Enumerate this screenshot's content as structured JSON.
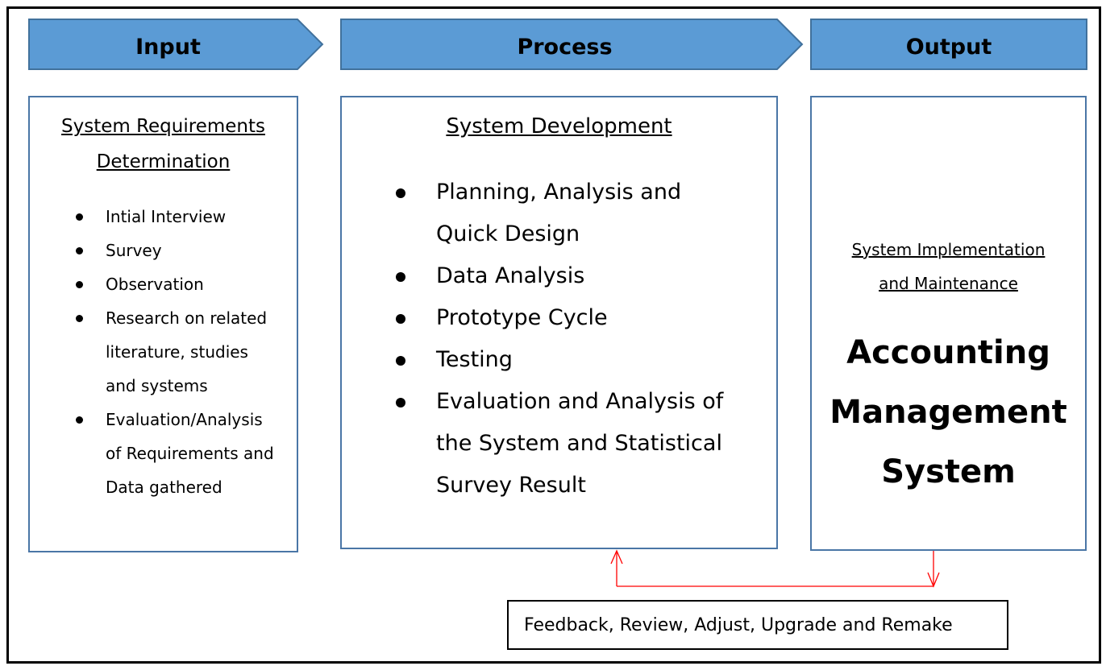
{
  "diagram": {
    "headers": {
      "input": "Input",
      "process": "Process",
      "output": "Output"
    },
    "input_box": {
      "title_line1": "System Requirements",
      "title_line2": "Determination",
      "items": [
        {
          "lines": [
            "Intial Interview"
          ]
        },
        {
          "lines": [
            "Survey"
          ]
        },
        {
          "lines": [
            "Observation"
          ]
        },
        {
          "lines": [
            "Research on related",
            "literature, studies",
            "and systems"
          ]
        },
        {
          "lines": [
            "Evaluation/Analysis",
            "of Requirements and",
            "Data gathered"
          ]
        }
      ]
    },
    "process_box": {
      "title": "System Development",
      "items": [
        {
          "lines": [
            "Planning, Analysis and",
            "Quick Design"
          ]
        },
        {
          "lines": [
            "Data Analysis"
          ]
        },
        {
          "lines": [
            "Prototype Cycle"
          ]
        },
        {
          "lines": [
            "Testing"
          ]
        },
        {
          "lines": [
            "Evaluation and Analysis of",
            "the System and Statistical",
            "Survey Result"
          ]
        }
      ]
    },
    "output_box": {
      "subtitle_line1": "System Implementation",
      "subtitle_line2": "and Maintenance",
      "main_line1": "Accounting",
      "main_line2": "Management",
      "main_line3": "System"
    },
    "feedback": {
      "label": "Feedback, Review, Adjust, Upgrade and Remake"
    },
    "colors": {
      "header_fill": "#5b9bd5",
      "header_stroke": "#41719c",
      "box_border": "#4a76a6",
      "feedback_arrow": "#ff0000"
    }
  }
}
